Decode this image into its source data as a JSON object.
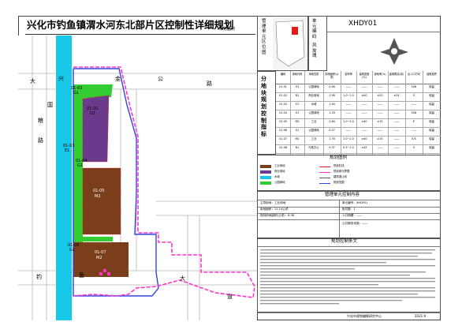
{
  "title": "兴化市钓鱼镇渭水河东北部片区控制性详细规划",
  "subtitle": "规划图则",
  "roads": {
    "top_left": "大",
    "top_left2": "兴",
    "top_mid": "金",
    "top_right": "公",
    "top_far": "路",
    "left_v1": "国",
    "left_v2": "粮",
    "left_v3": "路",
    "bottom_left": "钓",
    "bottom_mid": "鱼",
    "bottom_right": "大",
    "bottom_far": "道"
  },
  "plots": [
    {
      "code": "01-02",
      "sub": "G1"
    },
    {
      "code": "01-01",
      "sub": "G1"
    },
    {
      "code": "01-03",
      "sub": "E1"
    },
    {
      "code": "01-04",
      "sub": "G1"
    },
    {
      "code": "01-05",
      "sub": "M2"
    },
    {
      "code": "01-06",
      "sub": "G1"
    },
    {
      "code": "01-07",
      "sub": "M2"
    }
  ],
  "unit": {
    "header_left": "管理单元区位图",
    "code_label": "单元编码",
    "code_value": "XHDY01",
    "wind_label": "风玫瑰"
  },
  "indicator_title": "分地块规划控制指标",
  "indicator_table": {
    "headers": [
      "编码",
      "用地代码",
      "用地性质",
      "用地面积(公顷)",
      "容积率",
      "建筑密度(%)",
      "绿地率(%)",
      "建筑限高(米)",
      "出入口方向",
      "建筑退界"
    ],
    "rows": [
      [
        "01-01",
        "G1",
        "公园绿地",
        "0.46",
        "——",
        "——",
        "——",
        "——",
        "S/W",
        "保留"
      ],
      [
        "01-02",
        "B1",
        "商业用地",
        "1.98",
        "1.0~2.0",
        "≤40",
        "≥20",
        "≤24",
        "S",
        "保留"
      ],
      [
        "01-03",
        "E1",
        "水域",
        "1.94",
        "——",
        "——",
        "——",
        "——",
        "——",
        "保留"
      ],
      [
        "01-04",
        "G1",
        "公园绿地",
        "1.16",
        "——",
        "——",
        "——",
        "——",
        "S/W",
        "保留"
      ],
      [
        "01-05",
        "M2",
        "工业",
        "2.84",
        "1.0~2.0",
        "≥40",
        "≥15",
        "——",
        "E",
        "保留"
      ],
      [
        "01-06",
        "G1",
        "公园绿地",
        "0.27",
        "——",
        "——",
        "——",
        "——",
        "——",
        "保留"
      ],
      [
        "01-07",
        "M2",
        "工业",
        "1.78",
        "1.0~2.0",
        "≥40",
        "≥15",
        "——",
        "E/S",
        "保留"
      ],
      [
        "01-08",
        "B1",
        "行政办公",
        "0.37",
        "0.5~1.0",
        "≤35",
        "——",
        "——",
        "S",
        "保留"
      ]
    ]
  },
  "legend_title": "规划图例",
  "legend": [
    {
      "label": "工业用地",
      "color": "#7a3f1a"
    },
    {
      "label": "规划红线",
      "color": "#e21b1b"
    },
    {
      "label": "商业用地",
      "color": "#6a3a8c"
    },
    {
      "label": "规划单元界限",
      "color": "#ff33cc"
    },
    {
      "label": "水域",
      "color": "#18c8e8"
    },
    {
      "label": "建筑退让线",
      "color": "#555555"
    },
    {
      "label": "公园绿地",
      "color": "#33cc33"
    },
    {
      "label": "规划范围",
      "color": "#3344dd"
    }
  ],
  "mgmt_title": "管理单元控制内容",
  "mgmt": {
    "r1a": "主导用地：工业用地",
    "r1b": "单元编号：XHDY01",
    "r2a": "用地面积：11.14公顷",
    "r2b": "街坊数：1",
    "r3a": "规划用地面积(公顷)：8.58",
    "r3b": "人口规模：——",
    "r4": "公共服务设施：——"
  },
  "clauses_title": "规划控制条文",
  "footer_org": "兴化市规划编制研究中心",
  "footer_date": "2021.9"
}
